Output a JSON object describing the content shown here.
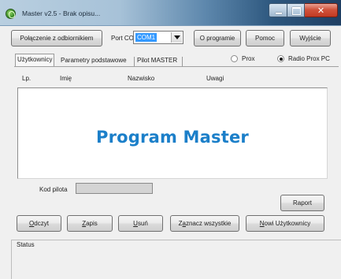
{
  "window": {
    "title": "Master v2.5 - Brak opisu..."
  },
  "toolbar": {
    "connect_label": "Połączenie z odbiornikiem",
    "port_label": "Port COM:",
    "port_value": "COM1",
    "about_label": "O programie",
    "help_label": "Pomoc",
    "exit_label": "Wyjście"
  },
  "tabs": [
    {
      "label": "Użytkownicy",
      "active": true
    },
    {
      "label": "Parametry podstawowe",
      "active": false
    },
    {
      "label": "Pilot MASTER",
      "active": false
    }
  ],
  "mode": {
    "options": [
      {
        "label": "Prox",
        "selected": false
      },
      {
        "label": "Radio Prox PC",
        "selected": true
      }
    ]
  },
  "list": {
    "columns": [
      "Lp.",
      "Imię",
      "Nazwisko",
      "Uwagi"
    ],
    "rows": [],
    "overlay_text": "Program Master"
  },
  "pilot": {
    "code_label": "Kod pilota",
    "code_value": ""
  },
  "actions": {
    "report_label": "Raport",
    "read": {
      "underline": "O",
      "rest": "dczyt"
    },
    "save": {
      "underline": "Z",
      "rest": "apis"
    },
    "delete": {
      "underline": "U",
      "rest": "suń"
    },
    "select_all": {
      "before": "Z",
      "underline": "a",
      "rest": "znacz wszystkie"
    },
    "new_user": {
      "underline": "N",
      "rest": "owi Użytkownicy"
    }
  },
  "status": {
    "title": "Status"
  },
  "colors": {
    "overlay_text": "#1b7fc9",
    "selection": "#3399ff",
    "close_button": "#c23a22"
  }
}
